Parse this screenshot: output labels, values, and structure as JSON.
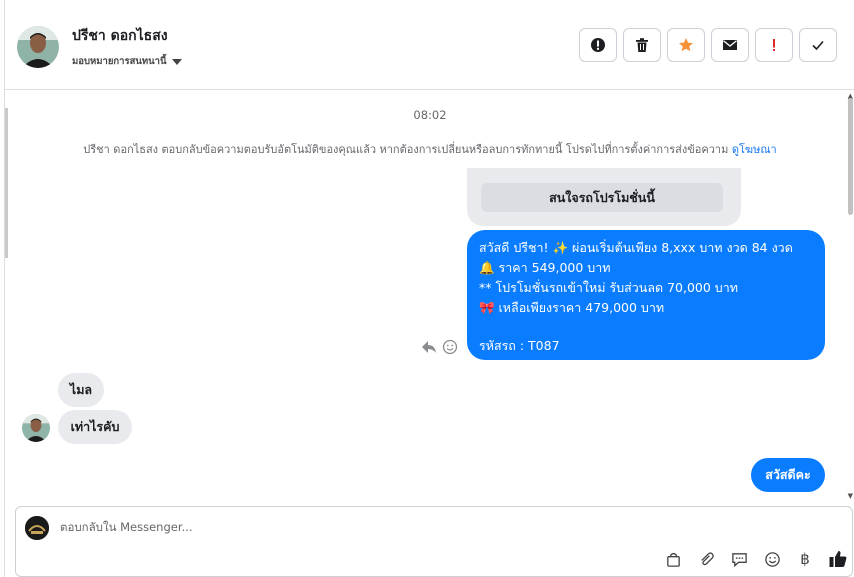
{
  "header": {
    "contact_name": "ปรีชา ดอกไธสง",
    "assign_label": "มอบหมายการสนทนานี้"
  },
  "conversation": {
    "time": "08:02",
    "notice_text": "ปรีชา ดอกไธสง ตอบกลับข้อความตอบรับอัตโนมัติของคุณแล้ว หากต้องการเปลี่ยนหรือลบการทักทายนี้ โปรดไปที่การตั้งค่าการส่งข้อความ",
    "notice_link": "ดูโฆษณา",
    "quick_reply": "สนใจรถโปรโมชั่นนี้",
    "promo_lines": [
      "สวัสดี ปรีชา! ✨  ผ่อนเริ่มต้นเพียง 8,xxx บาท งวด 84 งวด",
      "🔔 ราคา 549,000 บาท",
      "** โปรโมชั่นรถเข้าใหม่ รับส่วนลด 70,000 บาท",
      "🎀  เหลือเพียงราคา 479,000 บาท",
      "",
      " รหัสรถ : T087"
    ],
    "incoming": [
      "ไมล",
      "เท่าไรคับ"
    ],
    "outgoing_last": "สวัสดีคะ"
  },
  "composer": {
    "placeholder": "ตอบกลับใน Messenger..."
  },
  "colors": {
    "accent": "#0a7cff",
    "bubble_in": "#e9eaed",
    "star": "#f7923b",
    "alert": "#e02b2b"
  },
  "icons": {
    "actions": [
      "spam-icon",
      "trash-icon",
      "star-icon",
      "mail-icon",
      "exclamation-icon",
      "check-icon"
    ],
    "tools": [
      "bag-icon",
      "paperclip-icon",
      "saved-reply-icon",
      "emoji-icon",
      "baht-icon",
      "thumbs-up-icon"
    ]
  }
}
